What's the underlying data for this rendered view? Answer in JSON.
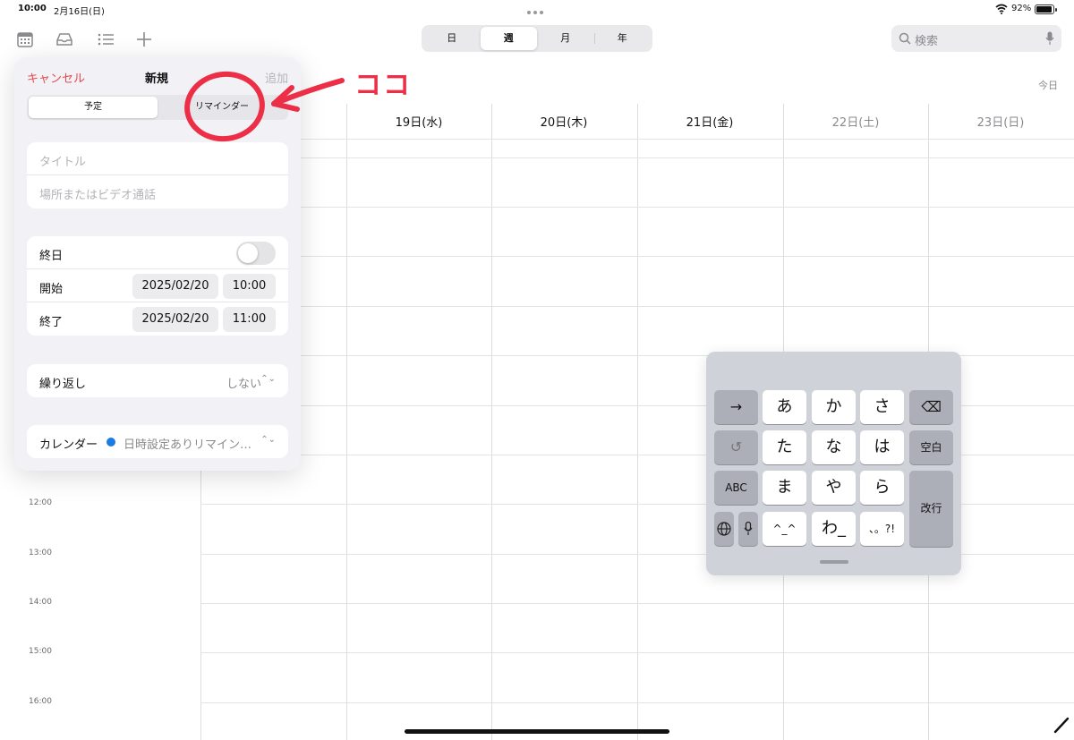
{
  "status_bar": {
    "time": "10:00",
    "date": "2月16日(日)",
    "battery": "92%"
  },
  "toolbar": {
    "views": [
      {
        "label": "日",
        "active": false
      },
      {
        "label": "週",
        "active": true
      },
      {
        "label": "月",
        "active": false
      },
      {
        "label": "年",
        "active": false
      }
    ],
    "search_placeholder": "検索",
    "today": "今日"
  },
  "week": {
    "days": [
      {
        "label": "19日(水)",
        "weekend": false
      },
      {
        "label": "20日(木)",
        "weekend": false
      },
      {
        "label": "21日(金)",
        "weekend": false
      },
      {
        "label": "22日(土)",
        "weekend": true
      },
      {
        "label": "23日(日)",
        "weekend": true
      }
    ],
    "hours": [
      "12:00",
      "13:00",
      "14:00",
      "15:00",
      "16:00"
    ]
  },
  "new_event": {
    "cancel": "キャンセル",
    "title": "新規",
    "add": "追加",
    "types": [
      "予定",
      "リマインダー"
    ],
    "title_placeholder": "タイトル",
    "location_placeholder": "場所またはビデオ通話",
    "all_day": {
      "label": "終日",
      "on": false
    },
    "start": {
      "label": "開始",
      "date": "2025/02/20",
      "time": "10:00"
    },
    "end": {
      "label": "終了",
      "date": "2025/02/20",
      "time": "11:00"
    },
    "repeat": {
      "label": "繰り返し",
      "value": "しない"
    },
    "calendar": {
      "label": "カレンダー",
      "value": "日時設定ありリマイン…",
      "color": "#1b7be5"
    }
  },
  "annotation": {
    "text": "ココ",
    "color": "#ec2f46"
  },
  "keyboard": {
    "rows": [
      [
        "→",
        "あ",
        "か",
        "さ",
        "⌫"
      ],
      [
        "↺",
        "た",
        "な",
        "は",
        "空白"
      ],
      [
        "ABC",
        "ま",
        "や",
        "ら",
        "改行"
      ],
      [
        "globe",
        "mic",
        "^_^",
        "わ_",
        "、。?!"
      ]
    ]
  }
}
